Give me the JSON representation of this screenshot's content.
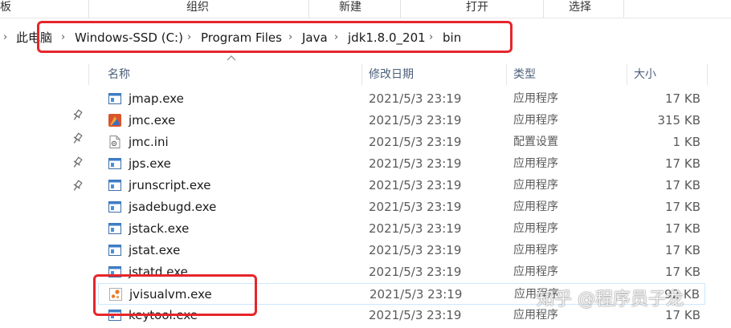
{
  "ribbon": {
    "groups": [
      "板",
      "组织",
      "新建",
      "打开",
      "选择"
    ]
  },
  "address": {
    "crumbs": [
      "此电脑",
      "Windows-SSD (C:)",
      "Program Files",
      "Java",
      "jdk1.8.0_201",
      "bin"
    ],
    "separator": "›"
  },
  "columns": {
    "name": "名称",
    "date": "修改日期",
    "type": "类型",
    "size": "大小"
  },
  "files": [
    {
      "name": "jmap.exe",
      "date": "2021/5/3 23:19",
      "type": "应用程序",
      "size": "17 KB",
      "icon": "exe-app-icon"
    },
    {
      "name": "jmc.exe",
      "date": "2021/5/3 23:19",
      "type": "应用程序",
      "size": "315 KB",
      "icon": "jmc-app-icon"
    },
    {
      "name": "jmc.ini",
      "date": "2021/5/3 23:19",
      "type": "配置设置",
      "size": "1 KB",
      "icon": "ini-settings-icon"
    },
    {
      "name": "jps.exe",
      "date": "2021/5/3 23:19",
      "type": "应用程序",
      "size": "17 KB",
      "icon": "exe-app-icon"
    },
    {
      "name": "jrunscript.exe",
      "date": "2021/5/3 23:19",
      "type": "应用程序",
      "size": "17 KB",
      "icon": "exe-app-icon"
    },
    {
      "name": "jsadebugd.exe",
      "date": "2021/5/3 23:19",
      "type": "应用程序",
      "size": "17 KB",
      "icon": "exe-app-icon"
    },
    {
      "name": "jstack.exe",
      "date": "2021/5/3 23:19",
      "type": "应用程序",
      "size": "17 KB",
      "icon": "exe-app-icon"
    },
    {
      "name": "jstat.exe",
      "date": "2021/5/3 23:19",
      "type": "应用程序",
      "size": "17 KB",
      "icon": "exe-app-icon"
    },
    {
      "name": "jstatd.exe",
      "date": "2021/5/3 23:19",
      "type": "应用程序",
      "size": "17 KB",
      "icon": "exe-app-icon"
    },
    {
      "name": "jvisualvm.exe",
      "date": "2021/5/3 23:19",
      "type": "应用程序",
      "size": "92 KB",
      "icon": "jvisualvm-app-icon"
    },
    {
      "name": "keytool.exe",
      "date": "2021/5/3 23:19",
      "type": "应用程序",
      "size": "17 KB",
      "icon": "exe-app-icon"
    }
  ],
  "watermark": "知乎 @程序员子龙",
  "colors": {
    "highlight_box": "#e5262b",
    "header_text": "#4c607a",
    "selection_border": "#cce8ff"
  }
}
